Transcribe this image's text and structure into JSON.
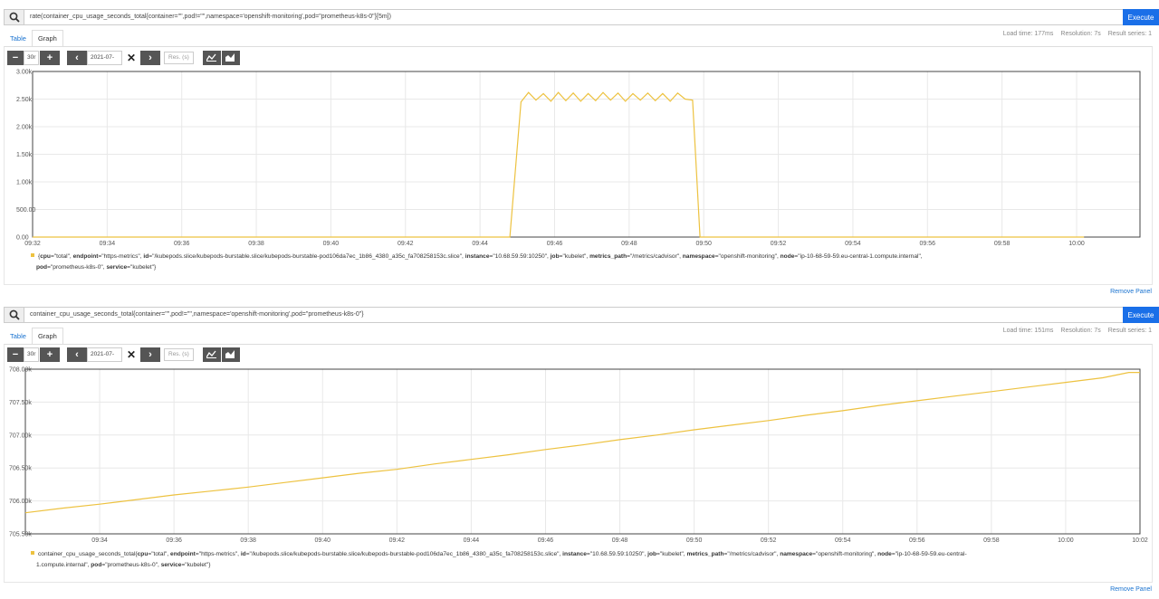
{
  "panels": [
    {
      "query": "rate(container_cpu_usage_seconds_total{container=\"\",pod!=\"\",namespace='openshift-monitoring',pod=\"prometheus-k8s-0\"}[5m])",
      "execute_label": "Execute",
      "tabs": [
        "Table",
        "Graph"
      ],
      "active_tab": "Graph",
      "load_time": "Load time: 177ms",
      "resolution": "Resolution: 7s",
      "result_series": "Result series: 1",
      "range_value": "30r",
      "end_time_value": "2021-07-",
      "resolution_placeholder": "Res. (s)",
      "legend_line1": "{cpu=\"total\", endpoint=\"https-metrics\", id=\"/kubepods.slice/kubepods-burstable.slice/kubepods-burstable-pod106da7ec_1b86_4380_a35c_fa708258153c.slice\", instance=\"10.68.59.59:10250\", job=\"kubelet\", metrics_path=\"/metrics/cadvisor\", namespace=\"openshift-monitoring\", node=\"ip-10-68-59-59.eu-central-1.compute.internal\",",
      "legend_line2": "pod=\"prometheus-k8s-0\", service=\"kubelet\"}",
      "remove_label": "Remove Panel"
    },
    {
      "query": "container_cpu_usage_seconds_total{container=\"\",pod!=\"\",namespace='openshift-monitoring',pod=\"prometheus-k8s-0\"}",
      "execute_label": "Execute",
      "tabs": [
        "Table",
        "Graph"
      ],
      "active_tab": "Graph",
      "load_time": "Load time: 151ms",
      "resolution": "Resolution: 7s",
      "result_series": "Result series: 1",
      "range_value": "30r",
      "end_time_value": "2021-07-",
      "resolution_placeholder": "Res. (s)",
      "legend_line1": "container_cpu_usage_seconds_total{cpu=\"total\", endpoint=\"https-metrics\", id=\"/kubepods.slice/kubepods-burstable.slice/kubepods-burstable-pod106da7ec_1b86_4380_a35c_fa708258153c.slice\", instance=\"10.68.59.59:10250\", job=\"kubelet\", metrics_path=\"/metrics/cadvisor\", namespace=\"openshift-monitoring\", node=\"ip-10-68-59-59.eu-central-",
      "legend_line2": "1.compute.internal\", pod=\"prometheus-k8s-0\", service=\"kubelet\"}",
      "remove_label": "Remove Panel"
    }
  ],
  "colors": {
    "series": "#edc240",
    "accent": "#1a6fe8",
    "link": "#1a73d0"
  },
  "chart_data": [
    {
      "type": "line",
      "y_ticks": [
        "0.00",
        "500.00",
        "1.00k",
        "1.50k",
        "2.00k",
        "2.50k",
        "3.00k"
      ],
      "x_ticks": [
        "09:32",
        "09:34",
        "09:36",
        "09:38",
        "09:40",
        "09:42",
        "09:44",
        "09:46",
        "09:48",
        "09:50",
        "09:52",
        "09:54",
        "09:56",
        "09:58",
        "10:00"
      ],
      "ylim": [
        0,
        3000
      ],
      "grid": true,
      "series": [
        {
          "values_note": "x in minutes past 09:00",
          "x": [
            32.0,
            44.8,
            45.1,
            45.3,
            45.5,
            45.7,
            45.9,
            46.1,
            46.3,
            46.5,
            46.7,
            46.9,
            47.1,
            47.3,
            47.5,
            47.7,
            47.9,
            48.1,
            48.3,
            48.5,
            48.7,
            48.9,
            49.1,
            49.3,
            49.5,
            49.7,
            49.9,
            60.2
          ],
          "y": [
            0,
            0,
            2450,
            2620,
            2480,
            2600,
            2460,
            2620,
            2470,
            2610,
            2460,
            2600,
            2470,
            2620,
            2480,
            2610,
            2460,
            2600,
            2480,
            2610,
            2470,
            2600,
            2460,
            2610,
            2500,
            2480,
            0,
            0
          ]
        }
      ]
    },
    {
      "type": "line",
      "y_ticks": [
        "705.50k",
        "706.00k",
        "706.50k",
        "707.00k",
        "707.50k",
        "708.00k"
      ],
      "x_ticks": [
        "09:34",
        "09:36",
        "09:38",
        "09:40",
        "09:42",
        "09:44",
        "09:46",
        "09:48",
        "09:50",
        "09:52",
        "09:54",
        "09:56",
        "09:58",
        "10:00",
        "10:02"
      ],
      "ylim": [
        705500,
        708000
      ],
      "grid": true,
      "series": [
        {
          "x": [
            32.0,
            33.0,
            34.0,
            35.0,
            36.0,
            37.0,
            38.0,
            39.0,
            40.0,
            41.0,
            42.0,
            43.0,
            44.0,
            45.0,
            46.0,
            47.0,
            48.0,
            49.0,
            50.0,
            51.0,
            52.0,
            53.0,
            54.0,
            55.0,
            56.0,
            57.0,
            58.0,
            59.0,
            60.0,
            61.0,
            61.7,
            62.0
          ],
          "y": [
            705820,
            705890,
            705950,
            706020,
            706090,
            706150,
            706210,
            706280,
            706350,
            706420,
            706480,
            706560,
            706630,
            706700,
            706780,
            706850,
            706930,
            707000,
            707080,
            707150,
            707220,
            707300,
            707370,
            707450,
            707520,
            707590,
            707660,
            707730,
            707800,
            707870,
            707950,
            707950
          ]
        }
      ]
    }
  ]
}
